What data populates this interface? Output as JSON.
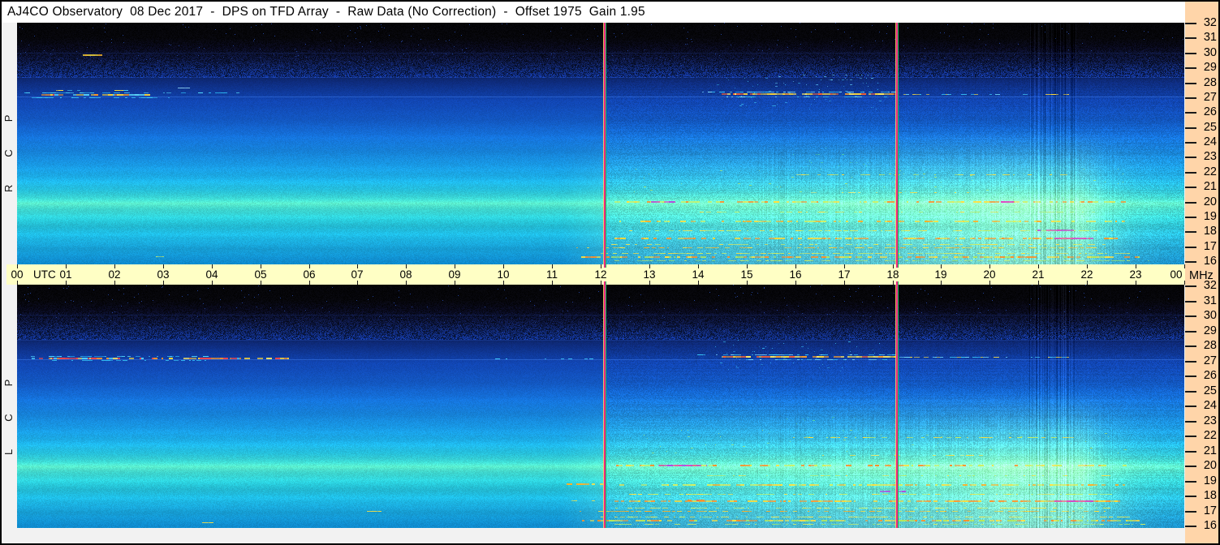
{
  "title": "AJ4CO Observatory  08 Dec 2017  -  DPS on TFD Array  -  Raw Data (No Correction)  -  Offset 1975  Gain 1.95",
  "window": {
    "border_color": "#000000",
    "titlebar_bg": "#ffffff",
    "margin_bg": "#f2f2f2",
    "time_strip_bg": "#ffffc5",
    "freq_strip_bg": "#ffd5a9",
    "tick_color": "#1a1a1a"
  },
  "panels": [
    {
      "id": "rcp",
      "polarization_label": "RCP"
    },
    {
      "id": "lcp",
      "polarization_label": "LCP"
    }
  ],
  "axes": {
    "time": {
      "unit_label": "UTC",
      "hour_labels": [
        "00",
        "01",
        "02",
        "03",
        "04",
        "05",
        "06",
        "07",
        "08",
        "09",
        "10",
        "11",
        "12",
        "13",
        "14",
        "15",
        "16",
        "17",
        "18",
        "19",
        "20",
        "21",
        "22",
        "23",
        "00"
      ]
    },
    "freq": {
      "unit_label": "MHz",
      "tick_values": [
        32,
        31,
        30,
        29,
        28,
        27,
        26,
        25,
        24,
        23,
        22,
        21,
        20,
        19,
        18,
        17,
        16
      ]
    }
  },
  "chart_data": {
    "type": "heatmap",
    "subtype": "radio-spectrogram",
    "title": "AJ4CO Observatory 08 Dec 2017 - DPS on TFD Array - Raw Data (No Correction) - Offset 1975 Gain 1.95",
    "x": {
      "label": "UTC",
      "range_hours": [
        0,
        24
      ]
    },
    "y": {
      "label": "MHz",
      "range_mhz": [
        16,
        32
      ],
      "top_value": 32
    },
    "panels": [
      "RCP",
      "LCP"
    ],
    "event_lines_utc": [
      12.08,
      18.09
    ],
    "event_line_style": {
      "edge_left": "#f8d860",
      "core": "#f02884",
      "edge_right": "#1cb85c"
    },
    "background_profile": [
      {
        "mhz": 32.0,
        "color": "#040406"
      },
      {
        "mhz": 31.0,
        "color": "#050509"
      },
      {
        "mhz": 30.3,
        "color": "#070818"
      },
      {
        "mhz": 29.5,
        "color": "#0a1234"
      },
      {
        "mhz": 28.7,
        "color": "#0c1f58"
      },
      {
        "mhz": 28.0,
        "color": "#0e2c7e"
      },
      {
        "mhz": 27.3,
        "color": "#0f3a9c"
      },
      {
        "mhz": 26.5,
        "color": "#1148b4"
      },
      {
        "mhz": 25.5,
        "color": "#135ac8"
      },
      {
        "mhz": 24.5,
        "color": "#146ed6"
      },
      {
        "mhz": 23.5,
        "color": "#1683de"
      },
      {
        "mhz": 22.5,
        "color": "#1897e2"
      },
      {
        "mhz": 21.5,
        "color": "#1cade2"
      },
      {
        "mhz": 20.8,
        "color": "#26c0dc"
      },
      {
        "mhz": 20.2,
        "color": "#3cd2cc"
      },
      {
        "mhz": 19.9,
        "color": "#55dcbe"
      },
      {
        "mhz": 19.5,
        "color": "#3ed4cc"
      },
      {
        "mhz": 18.8,
        "color": "#2accda"
      },
      {
        "mhz": 18.0,
        "color": "#20bee2"
      },
      {
        "mhz": 17.2,
        "color": "#1aacdf"
      },
      {
        "mhz": 16.5,
        "color": "#149bd8"
      },
      {
        "mhz": 16.0,
        "color": "#0f8ccf"
      }
    ],
    "bands": [
      {
        "mhz": 21.35,
        "width": 0.25,
        "amp": 0.07
      },
      {
        "mhz": 20.0,
        "width": 0.3,
        "amp": 0.1
      },
      {
        "mhz": 19.0,
        "width": 0.2,
        "amp": 0.06
      },
      {
        "mhz": 18.35,
        "width": 0.25,
        "amp": -0.06
      },
      {
        "mhz": 17.8,
        "width": 0.15,
        "amp": 0.05
      },
      {
        "mhz": 16.85,
        "width": 0.2,
        "amp": -0.05
      },
      {
        "mhz": 23.4,
        "width": 0.3,
        "amp": -0.04
      },
      {
        "mhz": 25.5,
        "width": 0.35,
        "amp": -0.04
      },
      {
        "mhz": 24.3,
        "width": 0.2,
        "amp": 0.04
      },
      {
        "mhz": 22.2,
        "width": 0.2,
        "amp": 0.04
      },
      {
        "mhz": 26.8,
        "width": 0.25,
        "amp": 0.05
      }
    ],
    "full_width_lines": [
      {
        "mhz": 27.05,
        "color": "#4a8cff",
        "alpha": 0.4
      },
      {
        "mhz": 28.35,
        "color": "#2a5ad0",
        "alpha": 0.3
      },
      {
        "mhz": 30.0,
        "color": "#1a2e6e",
        "alpha": 0.4
      }
    ],
    "day_glow": {
      "color": "#c8f598",
      "max_mhz": 25,
      "amp_points": [
        [
          11.2,
          0
        ],
        [
          12.4,
          0.3
        ],
        [
          14,
          0.42
        ],
        [
          16,
          0.55
        ],
        [
          18,
          0.7
        ],
        [
          19.5,
          0.85
        ],
        [
          20.3,
          1
        ],
        [
          21.9,
          1
        ],
        [
          22.4,
          0.5
        ],
        [
          23.0,
          0.25
        ],
        [
          23.6,
          0.15
        ],
        [
          24,
          0.12
        ]
      ]
    },
    "stripe_regions": [
      {
        "t0": 15.2,
        "t1": 22.6,
        "amp": 0.12
      },
      {
        "t0": 20.82,
        "t1": 21.78,
        "amp": 0.3
      }
    ],
    "speck_clusters": [
      {
        "panels": [
          "rcp",
          "lcp"
        ],
        "t": [
          14.3,
          17.8
        ],
        "f": [
          26.2,
          28.3
        ],
        "color": "#38b8f0",
        "density": 0.025
      },
      {
        "panels": [
          "rcp"
        ],
        "t": [
          15.6,
          17.6
        ],
        "f": [
          27.7,
          28.5
        ],
        "color": "#6ad8ff",
        "density": 0.05
      },
      {
        "panels": [
          "rcp"
        ],
        "t": [
          15.8,
          17.6
        ],
        "f": [
          22.2,
          23.6
        ],
        "color": "#58dca0",
        "density": 0.03
      },
      {
        "panels": [
          "lcp"
        ],
        "t": [
          15.8,
          17.4
        ],
        "f": [
          21.8,
          23.2
        ],
        "color": "#58dca0",
        "density": 0.02
      },
      {
        "panels": [
          "rcp",
          "lcp"
        ],
        "t": [
          0.4,
          3.2
        ],
        "f": [
          28.6,
          29.6
        ],
        "color": "#1a3a90",
        "density": 0.04
      },
      {
        "panels": [
          "rcp",
          "lcp"
        ],
        "t": [
          12.6,
          22.8
        ],
        "f": [
          20.6,
          22.3
        ],
        "color": "#a8e870",
        "density": 0.012
      }
    ],
    "streaks": [
      {
        "panels": [
          "rcp"
        ],
        "mhz": 29.85,
        "t": [
          1.35,
          1.75
        ],
        "w": 2,
        "density": 0.95,
        "colors": [
          "#ffe040",
          "#ffb828"
        ]
      },
      {
        "panels": [
          "rcp"
        ],
        "mhz": 27.3,
        "t": [
          0.15,
          4.6
        ],
        "w": 1,
        "density": 0.6,
        "colors": [
          "#2ab4f0",
          "#54dcff"
        ]
      },
      {
        "panels": [
          "rcp"
        ],
        "mhz": 27.15,
        "t": [
          0.5,
          2.8
        ],
        "w": 2,
        "density": 0.85,
        "colors": [
          "#ffd838",
          "#ff9828",
          "#ff4848",
          "#ffe860",
          "#60e0ff"
        ]
      },
      {
        "panels": [
          "rcp"
        ],
        "mhz": 27.0,
        "t": [
          0.3,
          3.5
        ],
        "w": 1,
        "density": 0.4,
        "colors": [
          "#34c4f4"
        ]
      },
      {
        "panels": [
          "rcp"
        ],
        "mhz": 27.5,
        "t": [
          0.8,
          2.3
        ],
        "w": 1,
        "density": 0.3,
        "colors": [
          "#44ccf4",
          "#ffe040"
        ]
      },
      {
        "panels": [
          "rcp"
        ],
        "mhz": 27.62,
        "t": [
          3.3,
          3.55
        ],
        "w": 1,
        "density": 0.9,
        "colors": [
          "#a0e8ff"
        ]
      },
      {
        "panels": [
          "lcp"
        ],
        "mhz": 27.1,
        "t": [
          0.05,
          5.6
        ],
        "w": 2,
        "density": 0.8,
        "colors": [
          "#ffd838",
          "#ff9828",
          "#ff4848",
          "#ffe860",
          "#50d8ff"
        ]
      },
      {
        "panels": [
          "lcp"
        ],
        "mhz": 27.25,
        "t": [
          0.2,
          4.2
        ],
        "w": 1,
        "density": 0.5,
        "colors": [
          "#2ab4f0",
          "#54dcff"
        ]
      },
      {
        "panels": [
          "lcp"
        ],
        "mhz": 26.95,
        "t": [
          0.5,
          4.0
        ],
        "w": 1,
        "density": 0.35,
        "colors": [
          "#34c4f4"
        ]
      },
      {
        "panels": [
          "lcp"
        ],
        "mhz": 27.1,
        "t": [
          9.4,
          12.0
        ],
        "w": 1,
        "density": 0.3,
        "colors": [
          "#40ccf8"
        ]
      },
      {
        "panels": [
          "rcp",
          "lcp"
        ],
        "mhz": 27.35,
        "t": [
          14.0,
          18.1
        ],
        "w": 1,
        "density": 0.55,
        "colors": [
          "#38c8f8",
          "#80e0ff"
        ]
      },
      {
        "panels": [
          "rcp",
          "lcp"
        ],
        "mhz": 27.2,
        "t": [
          14.5,
          18.1
        ],
        "w": 2,
        "density": 0.9,
        "colors": [
          "#ffd838",
          "#ffa028",
          "#ff6030",
          "#ffe860"
        ]
      },
      {
        "panels": [
          "rcp",
          "lcp"
        ],
        "mhz": 27.05,
        "t": [
          14.6,
          17.9
        ],
        "w": 1,
        "density": 0.5,
        "colors": [
          "#38c8f8",
          "#80e8ff"
        ]
      },
      {
        "panels": [
          "rcp",
          "lcp"
        ],
        "mhz": 27.2,
        "t": [
          18.15,
          20.55
        ],
        "w": 1,
        "density": 0.55,
        "colors": [
          "#38c8f8",
          "#74e0ff",
          "#ffe040"
        ]
      },
      {
        "panels": [
          "rcp",
          "lcp"
        ],
        "mhz": 27.2,
        "t": [
          20.7,
          21.65
        ],
        "w": 1,
        "density": 0.5,
        "colors": [
          "#ffd838",
          "#48d0f8"
        ]
      },
      {
        "panels": [
          "rcp",
          "lcp"
        ],
        "mhz": 21.85,
        "t": [
          15.9,
          21.9
        ],
        "w": 1,
        "density": 0.4,
        "colors": [
          "#ffe040",
          "#c8f060"
        ]
      },
      {
        "panels": [
          "rcp",
          "lcp"
        ],
        "mhz": 20.65,
        "t": [
          16.1,
          19.9
        ],
        "w": 1,
        "density": 0.28,
        "colors": [
          "#e8f080",
          "#ffe040"
        ]
      },
      {
        "panels": [
          "rcp",
          "lcp"
        ],
        "mhz": 19.95,
        "t": [
          12.3,
          22.9
        ],
        "w": 2,
        "density": 0.55,
        "colors": [
          "#ffe040",
          "#d0f060",
          "#ff9028"
        ]
      },
      {
        "panels": [
          "rcp"
        ],
        "mhz": 19.95,
        "t": [
          13.05,
          13.55
        ],
        "w": 2,
        "density": 0.9,
        "colors": [
          "#e048c0",
          "#b048e0"
        ]
      },
      {
        "panels": [
          "rcp"
        ],
        "mhz": 19.95,
        "t": [
          20.15,
          20.6
        ],
        "w": 2,
        "density": 0.85,
        "colors": [
          "#e048c0"
        ]
      },
      {
        "panels": [
          "lcp"
        ],
        "mhz": 19.95,
        "t": [
          13.2,
          14.2
        ],
        "w": 2,
        "density": 0.85,
        "colors": [
          "#b048e0",
          "#e048c0"
        ]
      },
      {
        "panels": [
          "rcp",
          "lcp"
        ],
        "mhz": 19.3,
        "t": [
          14.0,
          22.5
        ],
        "w": 1,
        "density": 0.3,
        "colors": [
          "#b8ec70",
          "#ffe040"
        ]
      },
      {
        "panels": [
          "rcp",
          "lcp"
        ],
        "mhz": 18.65,
        "t": [
          12.4,
          22.8
        ],
        "w": 2,
        "density": 0.55,
        "colors": [
          "#ffe040",
          "#ffb028",
          "#d8f060"
        ]
      },
      {
        "panels": [
          "lcp"
        ],
        "mhz": 18.7,
        "t": [
          11.3,
          12.1
        ],
        "w": 2,
        "density": 0.6,
        "colors": [
          "#ffe040",
          "#ffb028"
        ]
      },
      {
        "panels": [
          "rcp",
          "lcp"
        ],
        "mhz": 18.05,
        "t": [
          12.6,
          22.6
        ],
        "w": 1,
        "density": 0.5,
        "colors": [
          "#ffe040",
          "#c8f060"
        ]
      },
      {
        "panels": [
          "rcp"
        ],
        "mhz": 18.05,
        "t": [
          21.0,
          21.75
        ],
        "w": 2,
        "density": 0.9,
        "colors": [
          "#c048d8",
          "#e048c0"
        ]
      },
      {
        "panels": [
          "lcp"
        ],
        "mhz": 18.2,
        "t": [
          17.75,
          18.3
        ],
        "w": 2,
        "density": 0.85,
        "colors": [
          "#b048e0"
        ]
      },
      {
        "panels": [
          "rcp",
          "lcp"
        ],
        "mhz": 17.55,
        "t": [
          12.3,
          22.7
        ],
        "w": 2,
        "density": 0.6,
        "colors": [
          "#ffd838",
          "#ff9830"
        ]
      },
      {
        "panels": [
          "rcp",
          "lcp"
        ],
        "mhz": 17.55,
        "t": [
          21.35,
          22.15
        ],
        "w": 2,
        "density": 0.85,
        "colors": [
          "#d048c8",
          "#e048c0"
        ]
      },
      {
        "panels": [
          "lcp"
        ],
        "mhz": 17.6,
        "t": [
          13.8,
          14.15
        ],
        "w": 2,
        "density": 0.9,
        "colors": [
          "#ff4040",
          "#ff9028"
        ]
      },
      {
        "panels": [
          "lcp"
        ],
        "mhz": 17.6,
        "t": [
          11.4,
          12.1
        ],
        "w": 1,
        "density": 0.5,
        "colors": [
          "#ffe040"
        ]
      },
      {
        "panels": [
          "rcp",
          "lcp"
        ],
        "mhz": 17.15,
        "t": [
          12.2,
          22.5
        ],
        "w": 1,
        "density": 0.45,
        "colors": [
          "#ffe040",
          "#d0ec60"
        ]
      },
      {
        "panels": [
          "rcp",
          "lcp"
        ],
        "mhz": 16.9,
        "t": [
          11.5,
          22.4
        ],
        "w": 1,
        "density": 0.5,
        "colors": [
          "#ffe040",
          "#ffb028"
        ]
      },
      {
        "panels": [
          "rcp",
          "lcp"
        ],
        "mhz": 16.55,
        "t": [
          12.0,
          22.9
        ],
        "w": 1,
        "density": 0.55,
        "colors": [
          "#d0ec60",
          "#ffe040"
        ]
      },
      {
        "panels": [
          "rcp",
          "lcp"
        ],
        "mhz": 16.25,
        "t": [
          11.4,
          23.1
        ],
        "w": 2,
        "density": 0.65,
        "colors": [
          "#b8e858",
          "#ffe040",
          "#ff9028"
        ]
      },
      {
        "panels": [
          "rcp",
          "lcp"
        ],
        "mhz": 16.05,
        "t": [
          12.3,
          23.3
        ],
        "w": 1,
        "density": 0.55,
        "colors": [
          "#98e070",
          "#d0ec60"
        ]
      },
      {
        "panels": [
          "lcp"
        ],
        "mhz": 16.9,
        "t": [
          7.2,
          7.5
        ],
        "w": 1,
        "density": 0.8,
        "colors": [
          "#ffe040"
        ]
      },
      {
        "panels": [
          "rcp"
        ],
        "mhz": 16.3,
        "t": [
          2.85,
          3.1
        ],
        "w": 1,
        "density": 0.8,
        "colors": [
          "#d0ec60"
        ]
      },
      {
        "panels": [
          "lcp"
        ],
        "mhz": 16.15,
        "t": [
          3.8,
          4.05
        ],
        "w": 1,
        "density": 0.8,
        "colors": [
          "#ffe040"
        ]
      }
    ]
  }
}
